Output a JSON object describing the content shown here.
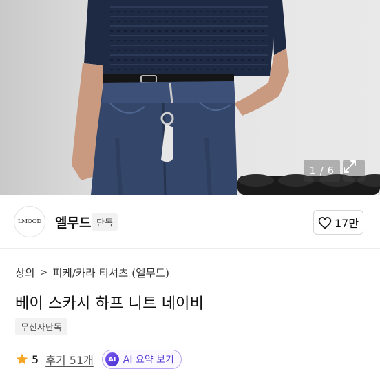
{
  "gallery": {
    "counter": "1 / 6"
  },
  "brand": {
    "logo_text": "LMOOD",
    "name": "엘무드",
    "badge": "단독"
  },
  "like": {
    "count": "17만"
  },
  "breadcrumb": {
    "category": "상의",
    "subcategory": "피케/카라 티셔츠 (엘무드)"
  },
  "product": {
    "title": "베이 스카시 하프 니트 네이비",
    "exclusive_badge": "무신사단독"
  },
  "reviews": {
    "rating": "5",
    "label": "후기 51개"
  },
  "ai_summary": {
    "chip": "AI",
    "label": "AI 요약 보기"
  },
  "colors": {
    "accent_star": "#f5a623",
    "ai_purple": "#5b3fd3",
    "knit_navy": "#1e2a44",
    "denim": "#34466a"
  }
}
